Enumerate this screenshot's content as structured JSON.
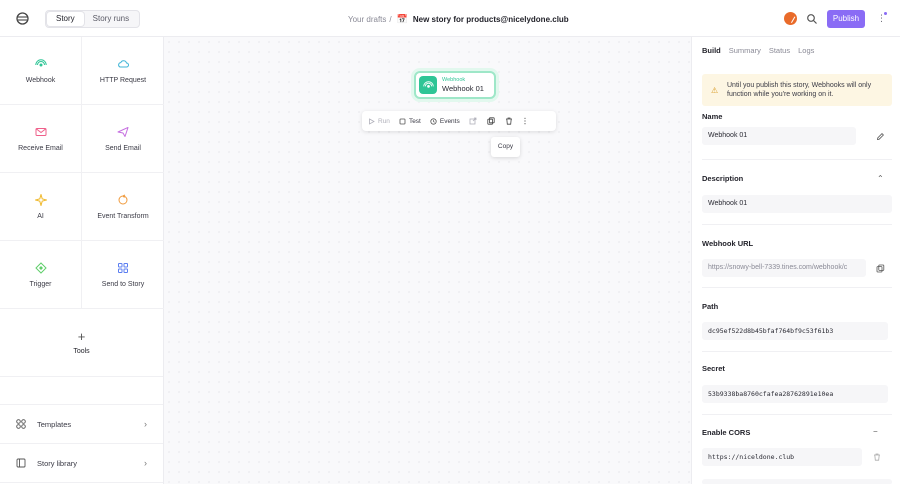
{
  "topbar": {
    "logo_icon": "tines-logo-icon",
    "tabs": [
      {
        "label": "Story",
        "active": true
      },
      {
        "label": "Story runs",
        "active": false
      }
    ],
    "crumb_prefix": "Your drafts",
    "crumb_sep": "/",
    "story_emoji": "📅",
    "story_name": "New story for products@nicelydone.club",
    "publish_label": "Publish",
    "more_label": "⋮",
    "accent": "#8a6cf5"
  },
  "sidebar": {
    "tiles": [
      {
        "label": "Webhook",
        "icon": "webhook-icon",
        "color": "#2fc596"
      },
      {
        "label": "HTTP Request",
        "icon": "cloud-icon",
        "color": "#3fb4d6"
      },
      {
        "label": "Receive Email",
        "icon": "mail-icon",
        "color": "#ef5f8a"
      },
      {
        "label": "Send Email",
        "icon": "send-icon",
        "color": "#c56ee0"
      },
      {
        "label": "AI",
        "icon": "sparkle-icon",
        "color": "#f0b92c"
      },
      {
        "label": "Event Transform",
        "icon": "transform-icon",
        "color": "#f09a3c"
      },
      {
        "label": "Trigger",
        "icon": "trigger-icon",
        "color": "#5fcf6a"
      },
      {
        "label": "Send to Story",
        "icon": "story-icon",
        "color": "#5b7ef0"
      }
    ],
    "tools_label": "Tools",
    "links": [
      {
        "label": "Templates",
        "icon": "templates-icon",
        "chevron": "›"
      },
      {
        "label": "Story library",
        "icon": "library-icon",
        "chevron": "›"
      }
    ]
  },
  "canvas": {
    "node": {
      "type_label": "Webhook",
      "name": "Webhook 01"
    },
    "toolbar": {
      "run": "Run",
      "test": "Test",
      "events": "Events"
    },
    "tooltip": "Copy"
  },
  "panel": {
    "tabs": [
      {
        "label": "Build",
        "active": true
      },
      {
        "label": "Summary",
        "active": false
      },
      {
        "label": "Status",
        "active": false
      },
      {
        "label": "Logs",
        "active": false
      }
    ],
    "warning_icon": "⚠",
    "warning": "Until you publish this story, Webhooks will only function while you're working on it.",
    "name_label": "Name",
    "name_value": "Webhook 01",
    "description_label": "Description",
    "description_value": "Webhook 01",
    "url_label": "Webhook URL",
    "url_value": "https://snowy-bell-7339.tines.com/webhook/c",
    "path_label": "Path",
    "path_value": "dc95ef522d8b45bfaf764bf9c53f61b3",
    "secret_label": "Secret",
    "secret_value": "53b9338ba8760cfafea28762891e10ea",
    "cors_label": "Enable CORS",
    "cors_value": "https://niceldone.club",
    "collapse_glyph": "⌃",
    "minus_glyph": "−"
  }
}
